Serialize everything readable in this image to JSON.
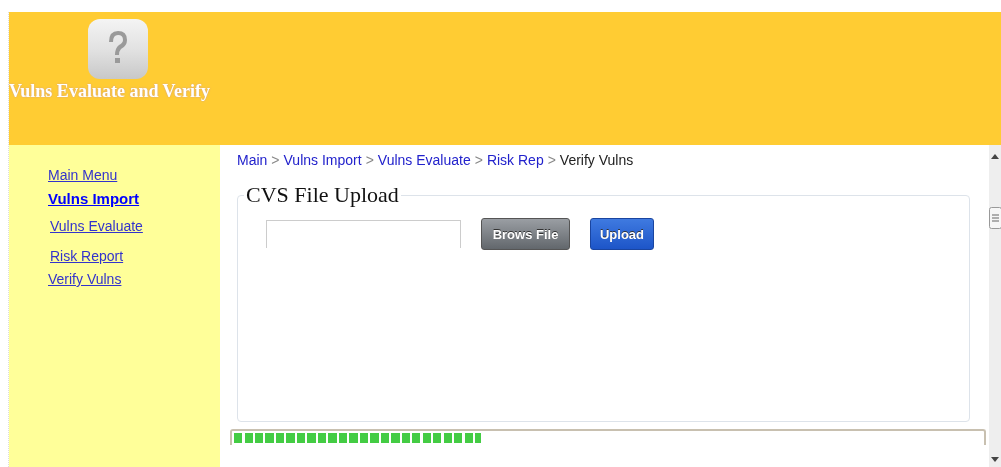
{
  "header": {
    "title": "Vulns Evaluate and Verify"
  },
  "sidebar": {
    "items": [
      {
        "label": "Main Menu",
        "selected": false
      },
      {
        "label": "Vulns Import",
        "selected": true
      },
      {
        "label": "Vulns Evaluate",
        "selected": false
      },
      {
        "label": "Risk Report",
        "selected": false
      },
      {
        "label": "Verify Vulns",
        "selected": false
      }
    ]
  },
  "breadcrumb": [
    {
      "label": "Main",
      "kind": "link"
    },
    {
      "label": "Vulns Import",
      "kind": "link"
    },
    {
      "label": "Vulns Evaluate",
      "kind": "link"
    },
    {
      "label": "Risk Rep",
      "kind": "link"
    },
    {
      "label": "Verify Vulns",
      "kind": "current"
    }
  ],
  "breadcrumb_separator": ">",
  "upload": {
    "legend": "CVS File Upload",
    "browse_button": "Brows File",
    "upload_button": "Upload"
  },
  "progress": {
    "level": 0.33
  }
}
